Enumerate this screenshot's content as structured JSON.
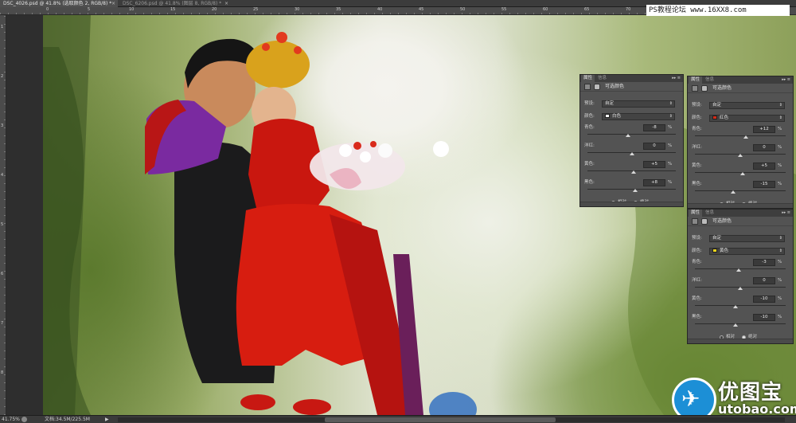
{
  "tabs": [
    {
      "label": "DSC_4026.psd @ 41.8% (选取颜色 2, RGB/8) *",
      "active": true
    },
    {
      "label": "DSC_6206.psd @ 41.8% (图层 8, RGB/8) *",
      "active": false
    }
  ],
  "ruler_top_numbers": [
    "0",
    "5",
    "10",
    "15",
    "20",
    "25",
    "30",
    "35",
    "40",
    "45",
    "50",
    "55",
    "60",
    "65",
    "70",
    "75",
    "80",
    "85"
  ],
  "ruler_left_numbers": [
    "1",
    "2",
    "3",
    "4",
    "5",
    "6",
    "7",
    "8"
  ],
  "watermark": {
    "top_text": "PS教程论坛 www.16XX8.com",
    "logo_name": "优图宝",
    "logo_url": "utobao.com"
  },
  "status": {
    "zoom": "41.75%",
    "doc_size": "文档:34.5M/225.5M",
    "arrow": "▶"
  },
  "panels": [
    {
      "tab_active": "属性",
      "tab_inactive": "信息",
      "controls": "▸▸ ≡",
      "title": "可选颜色",
      "preset_label": "预设:",
      "preset_value": "自定",
      "color_label": "颜色:",
      "color_value": "白色",
      "color_swatch": "#ffffff",
      "sliders": [
        {
          "label": "青色:",
          "value": "-8",
          "unit": "%",
          "level": -8
        },
        {
          "label": "洋红:",
          "value": "0",
          "unit": "%",
          "level": 0
        },
        {
          "label": "黄色:",
          "value": "+5",
          "unit": "%",
          "level": 5
        },
        {
          "label": "黑色:",
          "value": "+8",
          "unit": "%",
          "level": 8
        }
      ],
      "radio_relative": "相对",
      "radio_absolute": "绝对",
      "selected_method": "absolute"
    },
    {
      "tab_active": "属性",
      "tab_inactive": "信息",
      "controls": "▸▸ ≡",
      "title": "可选颜色",
      "preset_label": "预设:",
      "preset_value": "自定",
      "color_label": "颜色:",
      "color_value": "红色",
      "color_swatch": "#d62a16",
      "sliders": [
        {
          "label": "青色:",
          "value": "+12",
          "unit": "%",
          "level": 12
        },
        {
          "label": "洋红:",
          "value": "0",
          "unit": "%",
          "level": 0
        },
        {
          "label": "黄色:",
          "value": "+5",
          "unit": "%",
          "level": 5
        },
        {
          "label": "黑色:",
          "value": "-15",
          "unit": "%",
          "level": -15
        }
      ],
      "radio_relative": "相对",
      "radio_absolute": "绝对",
      "selected_method": "absolute"
    },
    {
      "tab_active": "属性",
      "tab_inactive": "信息",
      "controls": "▸▸ ≡",
      "title": "可选颜色",
      "preset_label": "预设:",
      "preset_value": "自定",
      "color_label": "颜色:",
      "color_value": "黄色",
      "color_swatch": "#f2d71c",
      "sliders": [
        {
          "label": "青色:",
          "value": "-3",
          "unit": "%",
          "level": -3
        },
        {
          "label": "洋红:",
          "value": "0",
          "unit": "%",
          "level": 0
        },
        {
          "label": "黄色:",
          "value": "-10",
          "unit": "%",
          "level": -10
        },
        {
          "label": "黑色:",
          "value": "-10",
          "unit": "%",
          "level": -10
        }
      ],
      "radio_relative": "相对",
      "radio_absolute": "绝对",
      "selected_method": "absolute"
    }
  ]
}
